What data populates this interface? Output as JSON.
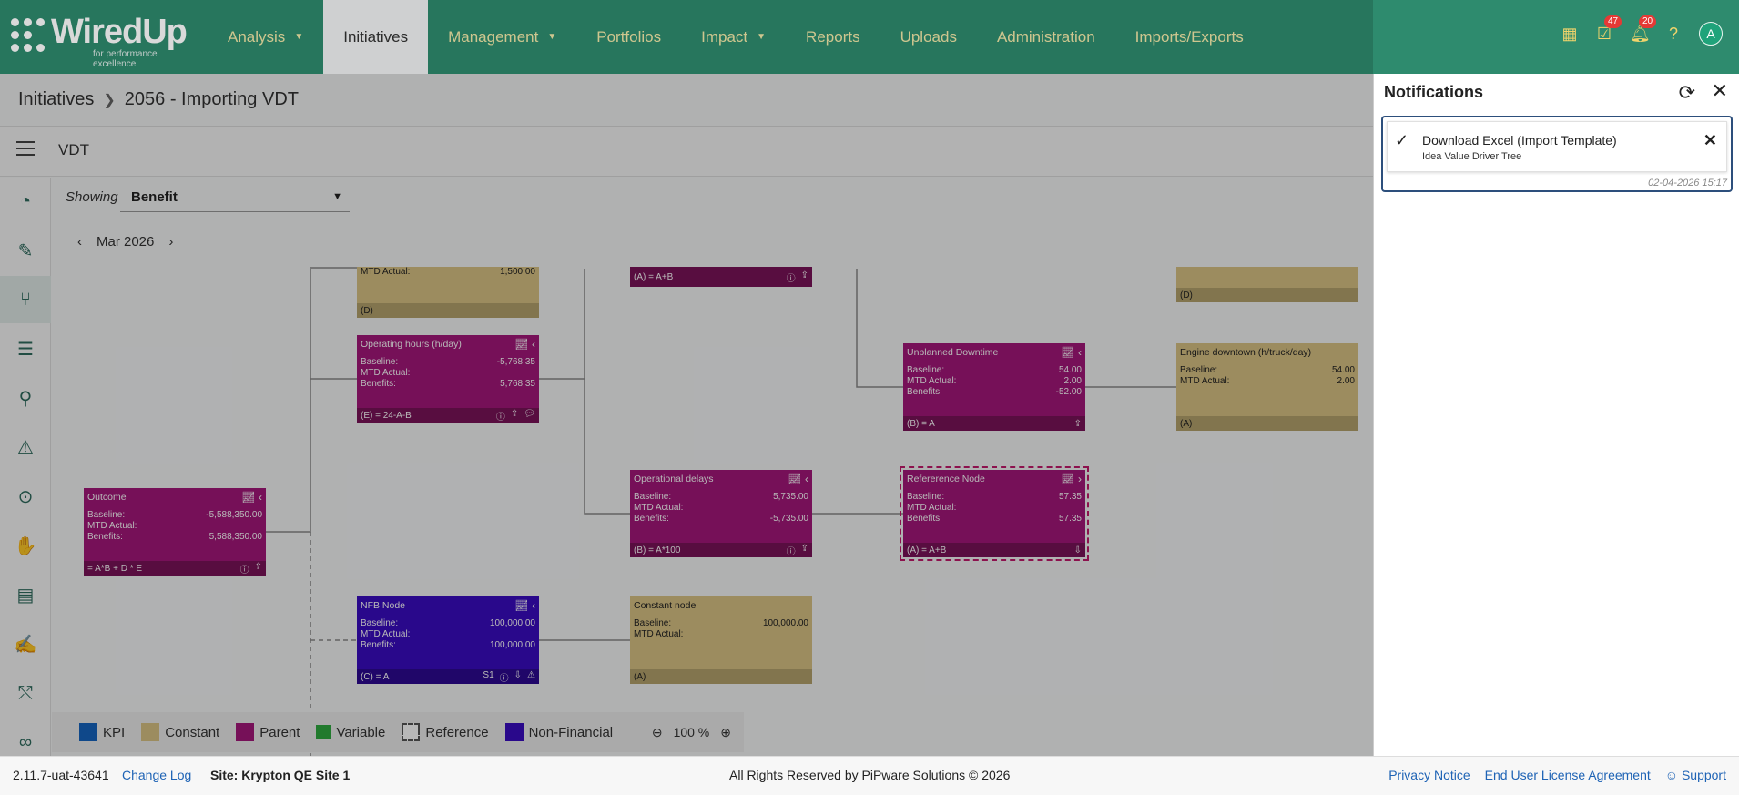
{
  "app": {
    "logo_name": "WiredUp",
    "logo_tagline": "for performance excellence"
  },
  "nav": [
    {
      "label": "Analysis",
      "has_menu": true
    },
    {
      "label": "Initiatives",
      "active": true
    },
    {
      "label": "Management",
      "has_menu": true
    },
    {
      "label": "Portfolios"
    },
    {
      "label": "Impact",
      "has_menu": true
    },
    {
      "label": "Reports"
    },
    {
      "label": "Uploads"
    },
    {
      "label": "Administration"
    },
    {
      "label": "Imports/Exports"
    }
  ],
  "header_icons": {
    "tasks_badge": "47",
    "notifications_badge": "20",
    "avatar_letter": "A"
  },
  "breadcrumb": {
    "root": "Initiatives",
    "current": "2056 - Importing VDT"
  },
  "subbar": {
    "title": "VDT"
  },
  "canvas": {
    "showing_label": "Showing",
    "showing_value": "Benefit",
    "period": "Mar 2026"
  },
  "nodes": {
    "top_left": {
      "title": "MTD Actual:",
      "value": "1,500.00",
      "formula": "(D)"
    },
    "top_mid": {
      "formula": "(A) = A+B"
    },
    "top_right": {
      "formula": "(D)"
    },
    "operating_hours": {
      "title": "Operating hours (h/day)",
      "baseline": "-5,768.35",
      "mtd": "",
      "benefits": "5,768.35",
      "formula": "(E) = 24-A-B"
    },
    "unplanned_downtime": {
      "title": "Unplanned Downtime",
      "baseline": "54.00",
      "mtd": "2.00",
      "benefits": "-52.00",
      "formula": "(B) = A"
    },
    "engine_downtime": {
      "title": "Engine downtown (h/truck/day)",
      "baseline": "54.00",
      "mtd": "2.00",
      "formula": "(A)"
    },
    "outcome": {
      "title": "Outcome",
      "baseline": "-5,588,350.00",
      "mtd": "",
      "benefits": "5,588,350.00",
      "formula": "= A*B + D * E"
    },
    "operational_delays": {
      "title": "Operational delays",
      "baseline": "5,735.00",
      "mtd": "",
      "benefits": "-5,735.00",
      "formula": "(B) = A*100"
    },
    "reference_node": {
      "title": "Refererence Node",
      "baseline": "57.35",
      "mtd": "",
      "benefits": "57.35",
      "formula": "(A) = A+B"
    },
    "nfb_node": {
      "title": "NFB Node",
      "baseline": "100,000.00",
      "mtd": "",
      "benefits": "100,000.00",
      "formula": "(C) = A",
      "tag": "S1"
    },
    "constant_node": {
      "title": "Constant node",
      "baseline": "100,000.00",
      "mtd": "",
      "formula": "(A)"
    }
  },
  "labels": {
    "baseline": "Baseline:",
    "mtd": "MTD Actual:",
    "benefits": "Benefits:"
  },
  "legend": {
    "items": [
      {
        "label": "KPI",
        "color": "#1565c0"
      },
      {
        "label": "Constant",
        "color": "#d8c284"
      },
      {
        "label": "Parent",
        "color": "#a4177a"
      },
      {
        "label": "Variable",
        "color": "#2eaa3f"
      },
      {
        "label": "Reference",
        "color": "#ffffff"
      },
      {
        "label": "Non-Financial",
        "color": "#3a0cc1"
      }
    ],
    "zoom": "100 %"
  },
  "notifications": {
    "title": "Notifications",
    "item": {
      "title": "Download Excel (Import Template)",
      "subtitle": "Idea Value Driver Tree",
      "date": "02-04-2026 15:17"
    }
  },
  "footer": {
    "version": "2.11.7-uat-43641",
    "change_log": "Change Log",
    "site": "Site: Krypton QE Site 1",
    "copyright": "All Rights Reserved by PiPware Solutions © 2026",
    "privacy": "Privacy Notice",
    "eula": "End User License Agreement",
    "support": "Support"
  },
  "colors": {
    "header": "#2e8b6e",
    "nav_text": "#f3e9a8",
    "parent": "#a4177a",
    "constant": "#d8c284",
    "non_financial": "#3a0cc1"
  }
}
